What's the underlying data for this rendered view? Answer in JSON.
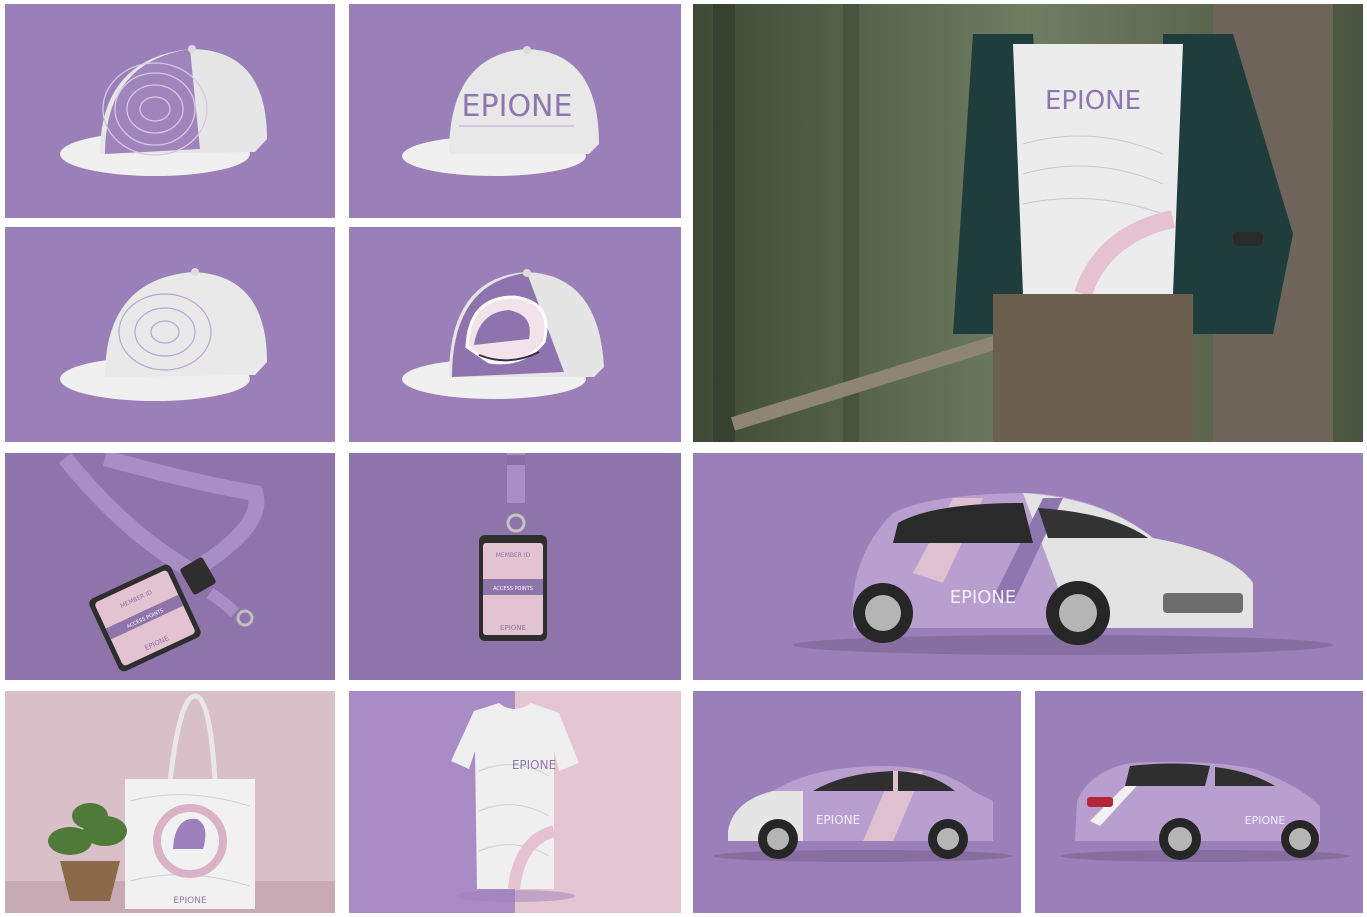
{
  "brand": {
    "name": "EPIONE",
    "colors": {
      "lavender": "#9b7fb8",
      "lavender_dark": "#8d74ab",
      "pink": "#e3c3cf",
      "white": "#f1f1f1",
      "gray": "#d8d8d8",
      "forest": "#4c5a3e"
    }
  },
  "tiles": [
    {
      "id": "cap-contour-side",
      "subject": "cap-icon"
    },
    {
      "id": "cap-logo-front",
      "subject": "cap-icon",
      "text": "EPIONE"
    },
    {
      "id": "forest-tshirt-model",
      "subject": "person-icon",
      "text": "EPIONE"
    },
    {
      "id": "cap-white-contour",
      "subject": "cap-icon"
    },
    {
      "id": "cap-butterfly",
      "subject": "cap-icon"
    },
    {
      "id": "lanyard-card-flat",
      "subject": "lanyard-icon",
      "card_lines": [
        "MEMBER ID",
        "ACCESS POINTS"
      ],
      "text": "EPIONE"
    },
    {
      "id": "lanyard-card-hanging",
      "subject": "badge-icon",
      "card_lines": [
        "MEMBER ID",
        "ACCESS POINTS"
      ],
      "text": "EPIONE"
    },
    {
      "id": "car-front-wrap",
      "subject": "car-icon",
      "text": "EPIONE"
    },
    {
      "id": "tote-bag-plant",
      "subject": "bag-icon",
      "text": "EPIONE"
    },
    {
      "id": "tshirt-split",
      "subject": "tshirt-icon",
      "text": "EPIONE"
    },
    {
      "id": "car-side-wrap",
      "subject": "car-icon",
      "text": "EPIONE"
    },
    {
      "id": "car-rear-wrap",
      "subject": "car-icon",
      "text": "EPIONE"
    }
  ]
}
